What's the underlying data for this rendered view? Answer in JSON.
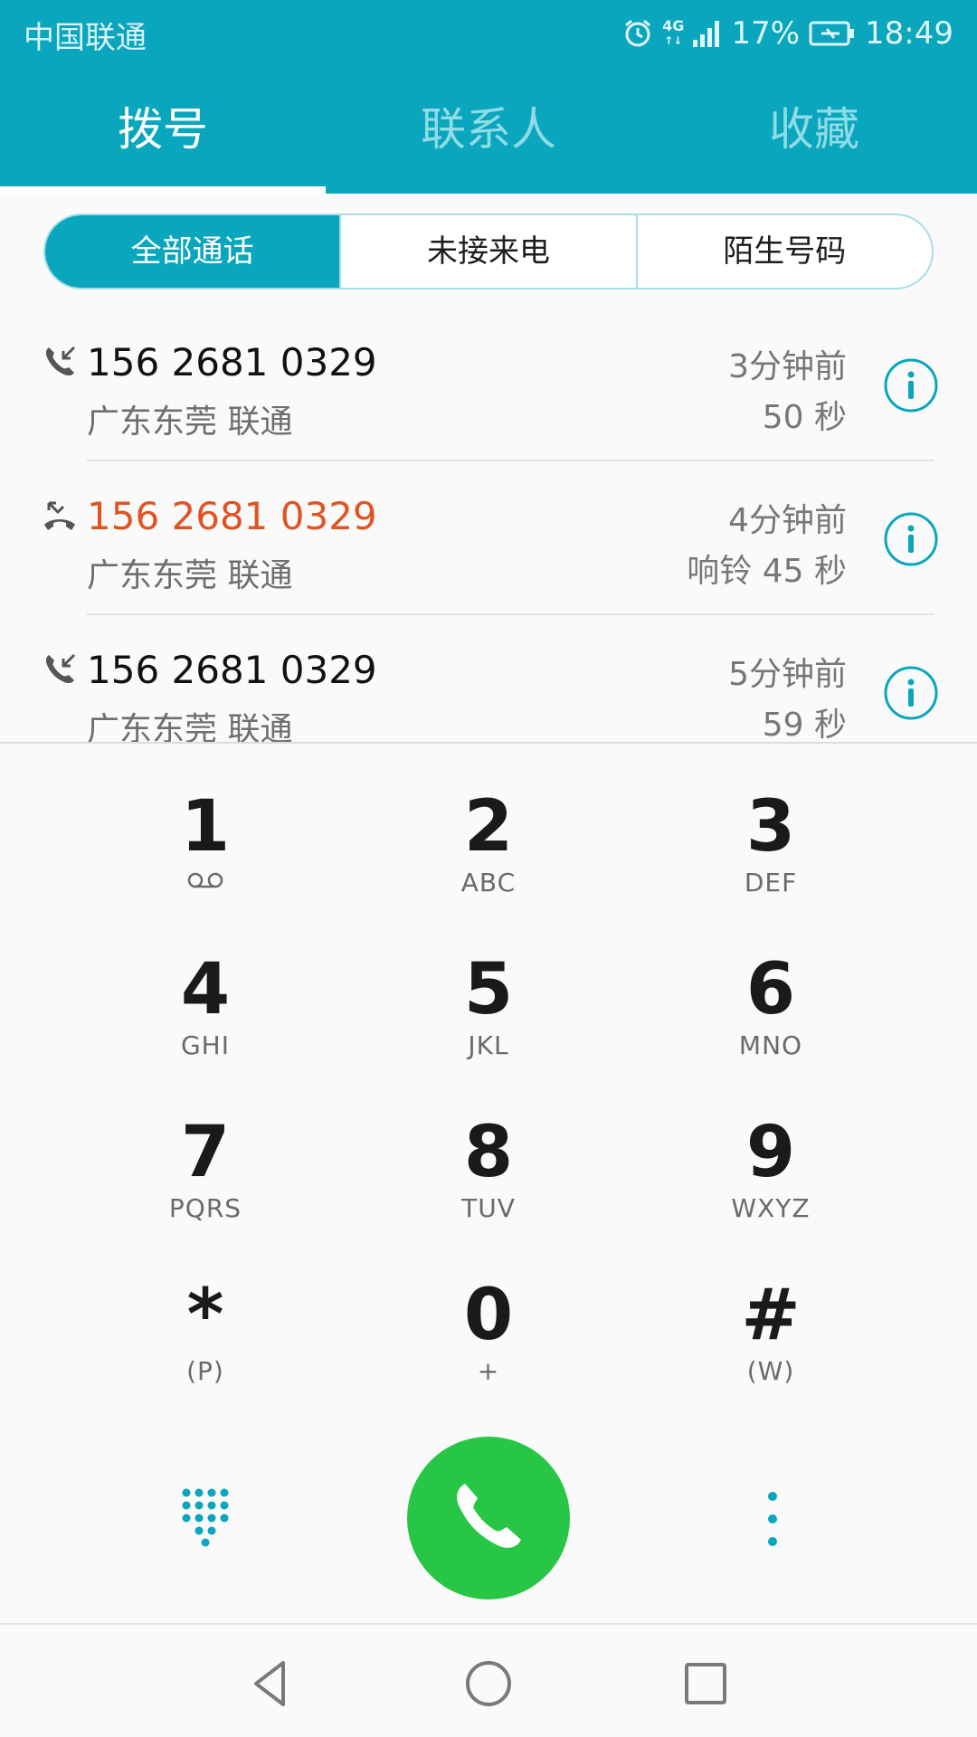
{
  "status": {
    "carrier": "中国联通",
    "network": "4G",
    "battery": "17%",
    "time": "18:49"
  },
  "tabs": [
    {
      "label": "拨号",
      "active": true
    },
    {
      "label": "联系人",
      "active": false
    },
    {
      "label": "收藏",
      "active": false
    }
  ],
  "filters": [
    {
      "label": "全部通话",
      "active": true
    },
    {
      "label": "未接来电",
      "active": false
    },
    {
      "label": "陌生号码",
      "active": false
    }
  ],
  "calls": [
    {
      "type": "incoming",
      "number": "156 2681 0329",
      "location": "广东东莞 联通",
      "time": "3分钟前",
      "duration": "50 秒"
    },
    {
      "type": "missed",
      "number": "156 2681 0329",
      "location": "广东东莞 联通",
      "time": "4分钟前",
      "duration": "响铃 45 秒"
    },
    {
      "type": "incoming",
      "number": "156 2681 0329",
      "location": "广东东莞 联通",
      "time": "5分钟前",
      "duration": "59 秒"
    }
  ],
  "keys": [
    {
      "digit": "1",
      "letters": ""
    },
    {
      "digit": "2",
      "letters": "ABC"
    },
    {
      "digit": "3",
      "letters": "DEF"
    },
    {
      "digit": "4",
      "letters": "GHI"
    },
    {
      "digit": "5",
      "letters": "JKL"
    },
    {
      "digit": "6",
      "letters": "MNO"
    },
    {
      "digit": "7",
      "letters": "PQRS"
    },
    {
      "digit": "8",
      "letters": "TUV"
    },
    {
      "digit": "9",
      "letters": "WXYZ"
    },
    {
      "digit": "*",
      "letters": "(P)"
    },
    {
      "digit": "0",
      "letters": "+"
    },
    {
      "digit": "#",
      "letters": "(W)"
    }
  ],
  "colors": {
    "accent": "#0aa6bd",
    "call": "#27c644",
    "missed": "#e05424"
  },
  "icons": {
    "voicemail": "voicemail-icon",
    "dialpad": "dialpad-grid-icon",
    "more": "more-vertical-icon",
    "call": "phone-icon",
    "info": "info-icon"
  }
}
